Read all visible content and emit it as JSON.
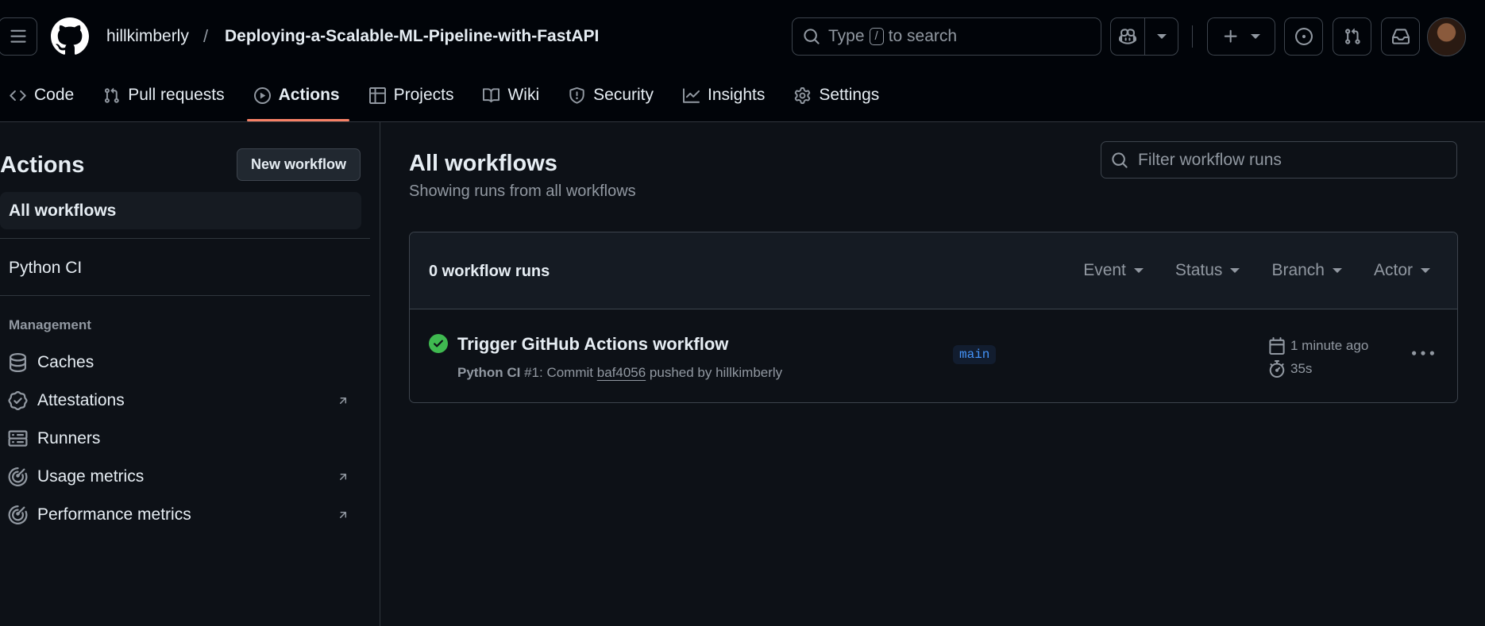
{
  "header": {
    "owner": "hillkimberly",
    "separator": "/",
    "repo": "Deploying-a-Scalable-ML-Pipeline-with-FastAPI",
    "search": {
      "prefix": "Type",
      "key": "/",
      "suffix": "to search"
    }
  },
  "nav": {
    "tabs": [
      {
        "label": "Code",
        "icon": "code-icon"
      },
      {
        "label": "Pull requests",
        "icon": "git-pull-request-icon"
      },
      {
        "label": "Actions",
        "icon": "play-icon",
        "active": true
      },
      {
        "label": "Projects",
        "icon": "table-icon"
      },
      {
        "label": "Wiki",
        "icon": "book-icon"
      },
      {
        "label": "Security",
        "icon": "shield-icon"
      },
      {
        "label": "Insights",
        "icon": "graph-icon"
      },
      {
        "label": "Settings",
        "icon": "gear-icon"
      }
    ]
  },
  "sidebar": {
    "title": "Actions",
    "new_workflow": "New workflow",
    "items": [
      {
        "label": "All workflows",
        "selected": true
      },
      {
        "label": "Python CI"
      }
    ],
    "management_heading": "Management",
    "management": [
      {
        "label": "Caches",
        "icon": "database-icon",
        "external": false
      },
      {
        "label": "Attestations",
        "icon": "verified-icon",
        "external": true
      },
      {
        "label": "Runners",
        "icon": "server-icon",
        "external": false
      },
      {
        "label": "Usage metrics",
        "icon": "meter-icon",
        "external": true
      },
      {
        "label": "Performance metrics",
        "icon": "meter-icon",
        "external": true
      }
    ]
  },
  "main": {
    "title": "All workflows",
    "subtitle": "Showing runs from all workflows",
    "filter_placeholder": "Filter workflow runs",
    "runs_count": "0 workflow runs",
    "filters": [
      "Event",
      "Status",
      "Branch",
      "Actor"
    ],
    "runs": [
      {
        "title": "Trigger GitHub Actions workflow",
        "workflow": "Python CI",
        "run_number": "#1",
        "commit_prefix": ": Commit",
        "sha": "baf4056",
        "pushed_by": "pushed by hillkimberly",
        "branch": "main",
        "when": "1 minute ago",
        "duration": "35s",
        "status": "success"
      }
    ]
  },
  "colors": {
    "background": "#0d1117",
    "header_bg": "#010409",
    "accent_underline": "#f78166",
    "success": "#3fb950",
    "link": "#4493f8"
  }
}
